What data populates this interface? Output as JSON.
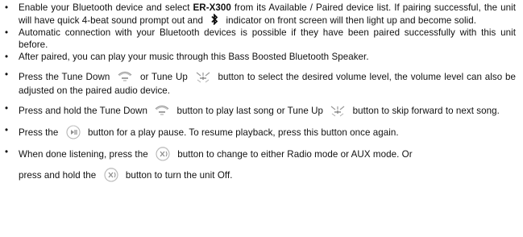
{
  "items": [
    {
      "t1": "Enable your Bluetooth device and select ",
      "model": "ER-X300",
      "t2": " from its Available / Paired device list. If pairing successful, the unit will have quick 4-beat sound prompt out and ",
      "t3": " indicator on front screen will then light up and become solid."
    },
    {
      "text": "Automatic connection with your Bluetooth devices is possible if they have been paired successfully with this unit before."
    },
    {
      "text": "After paired, you can play your music through this Bass Boosted Bluetooth Speaker."
    },
    {
      "t1": "Press the Tune Down ",
      "t2": " or Tune Up ",
      "t3": " button to select the desired volume level, the volume level can also be adjusted on the paired audio device."
    },
    {
      "t1": "Press and hold the Tune Down ",
      "t2": " button to play last song or Tune Up ",
      "t3": " button to skip forward to next song."
    },
    {
      "t1": "Press the ",
      "t2": " button for a play pause. To resume playback, press this button once again."
    },
    {
      "t1": "When done listening, press the ",
      "t2": " button to change to either Radio mode or AUX mode. Or",
      "t3": "press and hold the ",
      "t4": " button to turn the unit Off."
    }
  ],
  "bullet": "•",
  "icons": {
    "bluetooth": "bluetooth-icon",
    "tune_down": "tune-down-icon",
    "tune_up": "tune-up-icon",
    "play_pause": "play-pause-icon",
    "mode": "mode-icon"
  }
}
